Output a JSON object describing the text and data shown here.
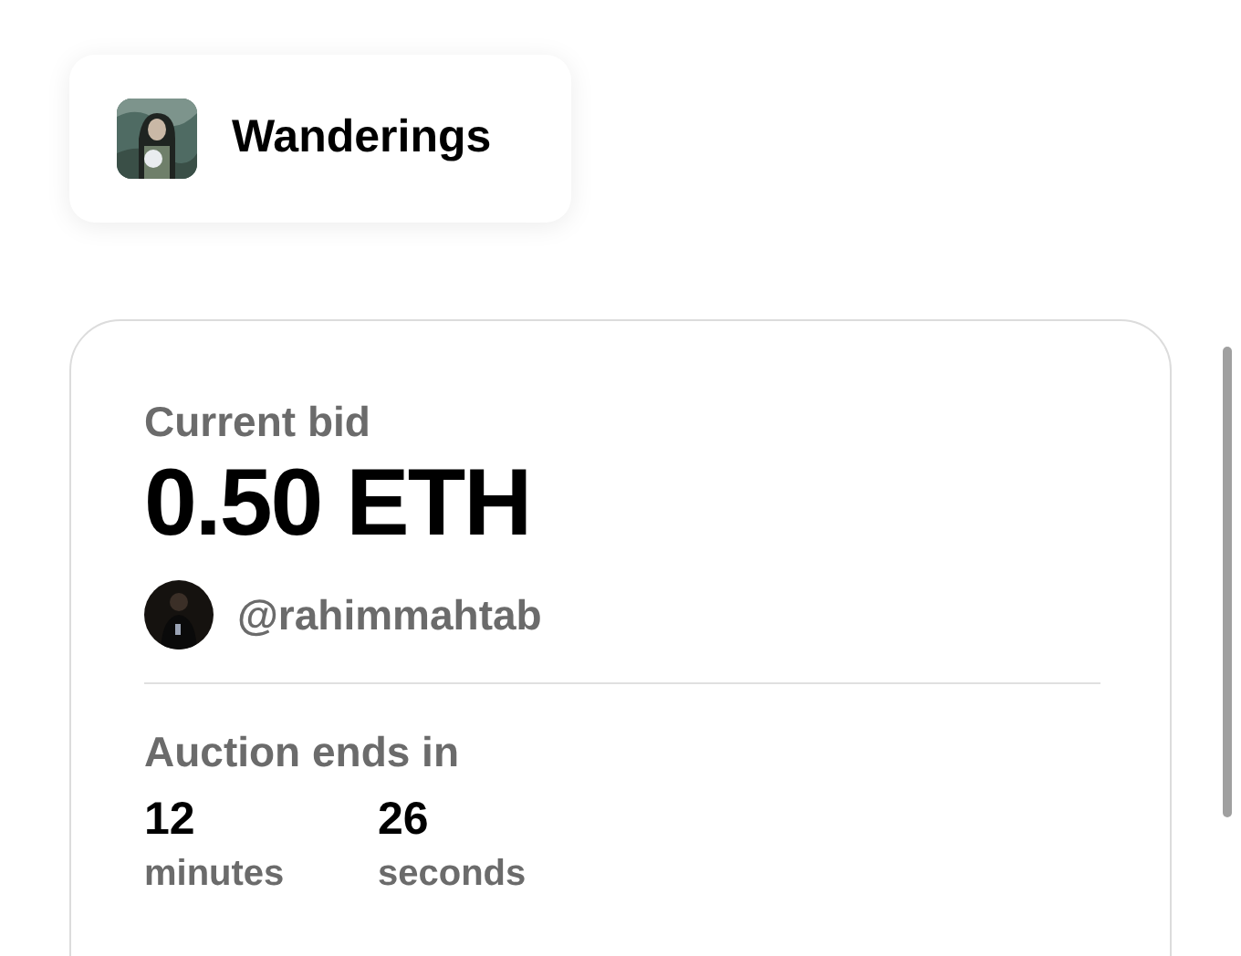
{
  "collection": {
    "name": "Wanderings",
    "kind": "picture"
  },
  "bid": {
    "label": "Current bid",
    "amount": "0.50 ETH",
    "owner": "@rahimmahtab"
  },
  "auction": {
    "label": "Auction ends in",
    "units": [
      {
        "value": "12",
        "unit": "minutes"
      },
      {
        "value": "26",
        "unit": "seconds"
      }
    ]
  }
}
